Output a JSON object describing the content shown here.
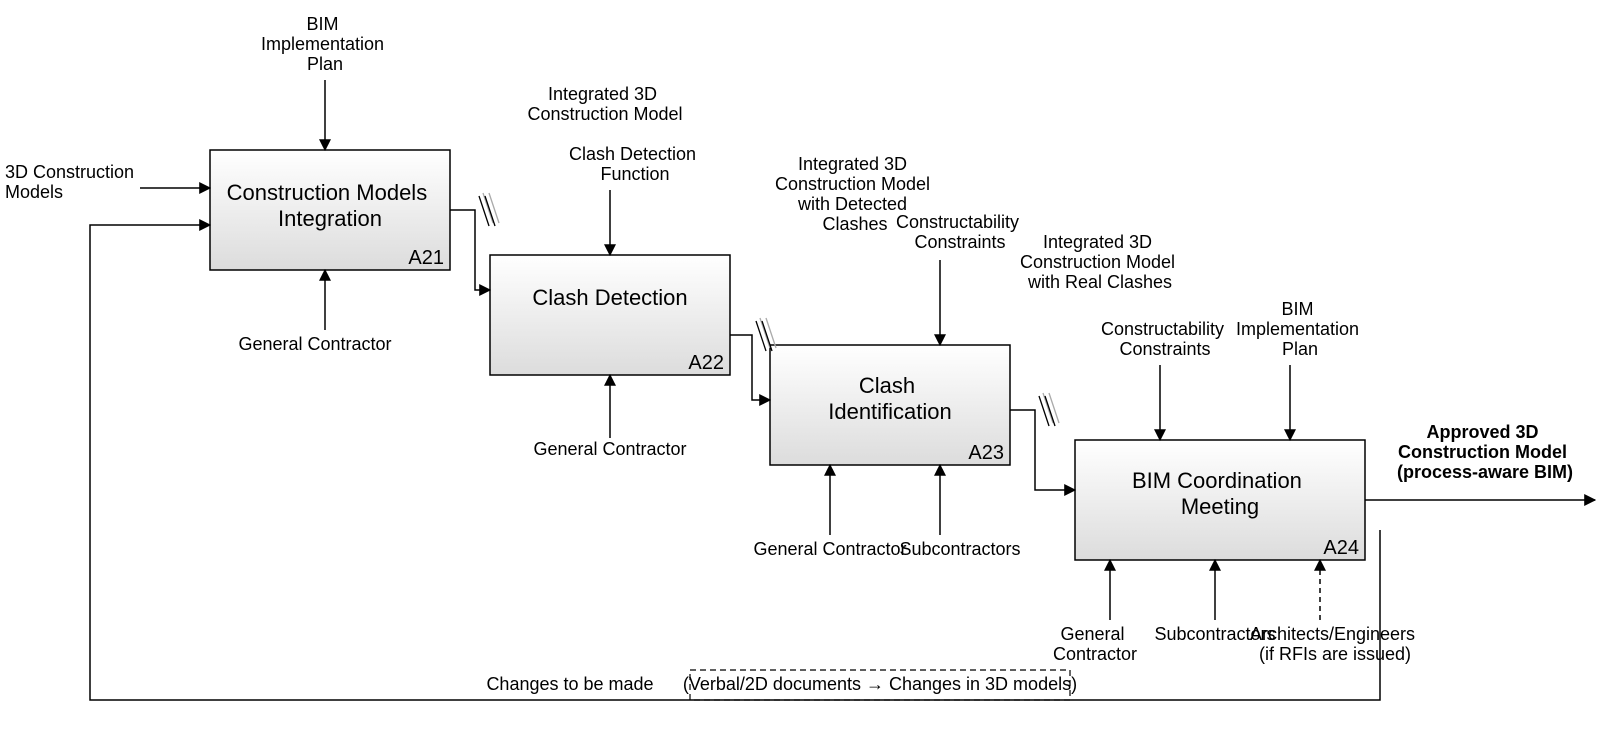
{
  "boxes": {
    "a21": {
      "title": "Construction Models\nIntegration",
      "id": "A21"
    },
    "a22": {
      "title": "Clash Detection",
      "id": "A22"
    },
    "a23": {
      "title": "Clash\nIdentification",
      "id": "A23"
    },
    "a24": {
      "title": "BIM Coordination\nMeeting",
      "id": "A24"
    }
  },
  "labels": {
    "in_models": "3D Construction\nModels",
    "bim_plan": "BIM\nImplementation\nPlan",
    "gc": "General Contractor",
    "int_model": "Integrated 3D\nConstruction Model",
    "cd_func": "Clash Detection\nFunction",
    "int_model_clashes": "Integrated 3D\nConstruction Model\nwith Detected\nClashes",
    "constr_constraints": "Constructability\nConstraints",
    "int_model_real": "Integrated 3D\nConstruction Model\nwith Real Clashes",
    "subcontractors": "Subcontractors",
    "gc2": "General\nContractor",
    "arch_eng": "Architects/Engineers\n(if RFIs are issued)",
    "output": "Approved 3D\nConstruction Model\n(process-aware BIM)",
    "changes": "Changes to be made",
    "changes_note": "(Verbal/2D documents → Changes in 3D models)"
  }
}
